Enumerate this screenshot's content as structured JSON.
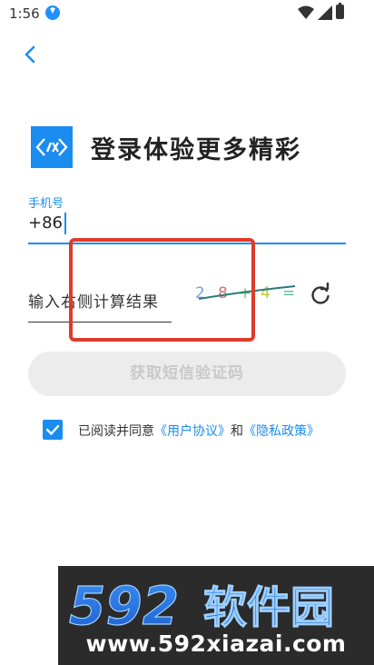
{
  "status_bar": {
    "time": "1:56"
  },
  "header": {
    "title": "登录体验更多精彩"
  },
  "phone": {
    "label": "手机号",
    "prefix": "+86"
  },
  "captcha": {
    "placeholder": "输入右侧计算结果",
    "image_text": [
      "2",
      "8",
      "+",
      "4",
      "="
    ]
  },
  "actions": {
    "get_code_label": "获取短信验证码"
  },
  "agreement": {
    "checked": true,
    "prefix": "已阅读并同意",
    "user_agreement": "《用户协议》",
    "and": "和",
    "privacy_policy": "《隐私政策》"
  },
  "watermark": {
    "brand_digits": "592",
    "brand_name": "软件园",
    "url": "www.592xiazai.com"
  },
  "colors": {
    "accent": "#1a8cf0",
    "highlight": "#e03a2a",
    "button_disabled_bg": "#ececec"
  }
}
